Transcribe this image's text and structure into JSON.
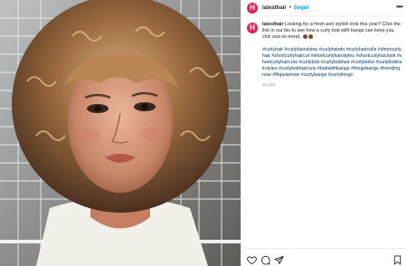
{
  "header": {
    "avatar_letter": "H",
    "username": "latesthair",
    "separator": "•",
    "follow_label": "Segui",
    "more_label": "•••"
  },
  "caption": {
    "avatar_letter": "H",
    "username": "latesthair",
    "text": "Looking for a fresh and stylish look this year? Click the link in our bio to see how a curly bob with bangs can keep you chic and on-trend.",
    "hashtags": "#curlyhair #curlyhairstyles #curlyhairdo #curlyhaircolls #shortcurlyhair #shortcurlyhaircut #shortcurlyhairstyles #shortcurlyhaclook #shortcurlyhaircuts #curlybob #curlybobhair #curlyboho #curlybobhairstyles #curlybobhaircuts #bobwithbangs #fringebangs #trendingnow #fhipularnow #curlybangs #curlyfringe",
    "time": "31 sett"
  },
  "actions": {
    "like": "heart-icon",
    "comment": "comment-icon",
    "share": "share-icon",
    "save": "bookmark-icon"
  },
  "colors": {
    "accent_avatar": "#e0245e",
    "follow": "#0095f6",
    "hashtag": "#00376b"
  }
}
